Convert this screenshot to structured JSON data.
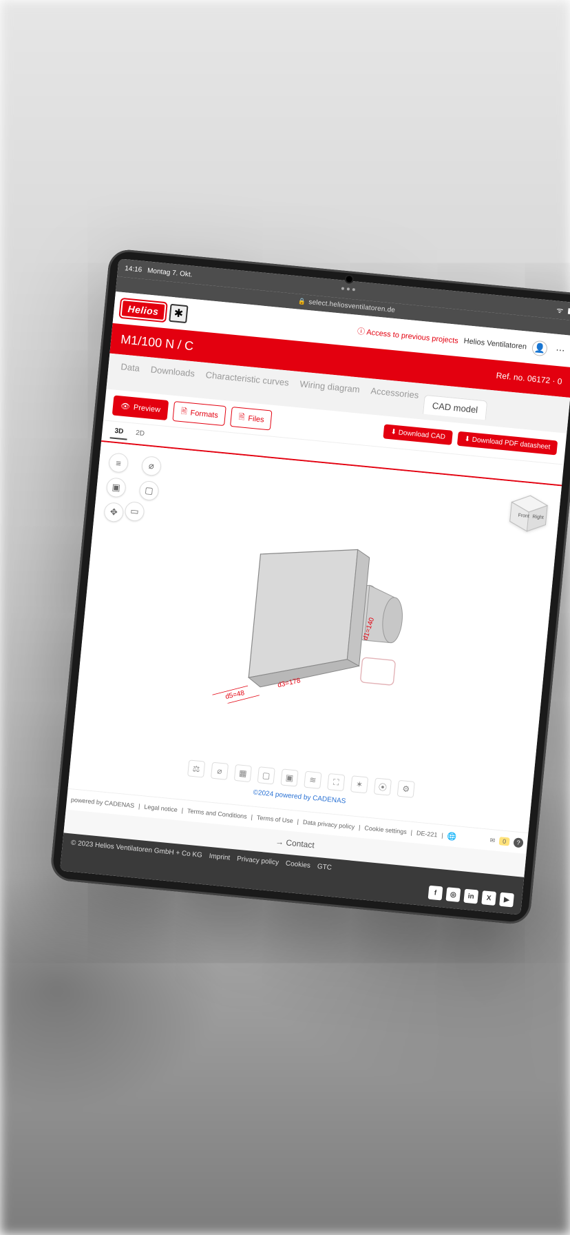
{
  "status": {
    "time": "14:16",
    "date": "Montag 7. Okt."
  },
  "address": {
    "host": "select.heliosventilatoren.de"
  },
  "brand": {
    "name": "Helios"
  },
  "header": {
    "previousLink": "Access to previous projects",
    "company": "Helios Ventilatoren"
  },
  "redbar": {
    "title": "M1/100 N / C",
    "ref": "Ref. no. 06172 · 0"
  },
  "tabs": [
    "Data",
    "Downloads",
    "Characteristic curves",
    "Wiring diagram",
    "Accessories"
  ],
  "activeTab": "CAD model",
  "subTabs": {
    "preview": "Preview",
    "formats": "Formats",
    "files": "Files"
  },
  "downloads": {
    "cad": "Download CAD",
    "pdf": "Download PDF datasheet"
  },
  "viewTabs": {
    "threeD": "3D",
    "twoD": "2D"
  },
  "cube": {
    "front": "Front",
    "right": "Right"
  },
  "dims": {
    "d1": "d1=140",
    "d3": "d3=178",
    "d5": "d5=48"
  },
  "cadenas": "©2024 powered by CADENAS",
  "footerLinks": [
    "powered by CADENAS",
    "Legal notice",
    "Terms and Conditions",
    "Terms of Use",
    "Data privacy policy",
    "Cookie settings",
    "DE-221"
  ],
  "mailbadge": "0",
  "contact": "Contact",
  "sitefooter": {
    "copyright": "© 2023 Helios Ventilatoren GmbH + Co KG",
    "links": [
      "Imprint",
      "Privacy policy",
      "Cookies",
      "GTC"
    ]
  }
}
